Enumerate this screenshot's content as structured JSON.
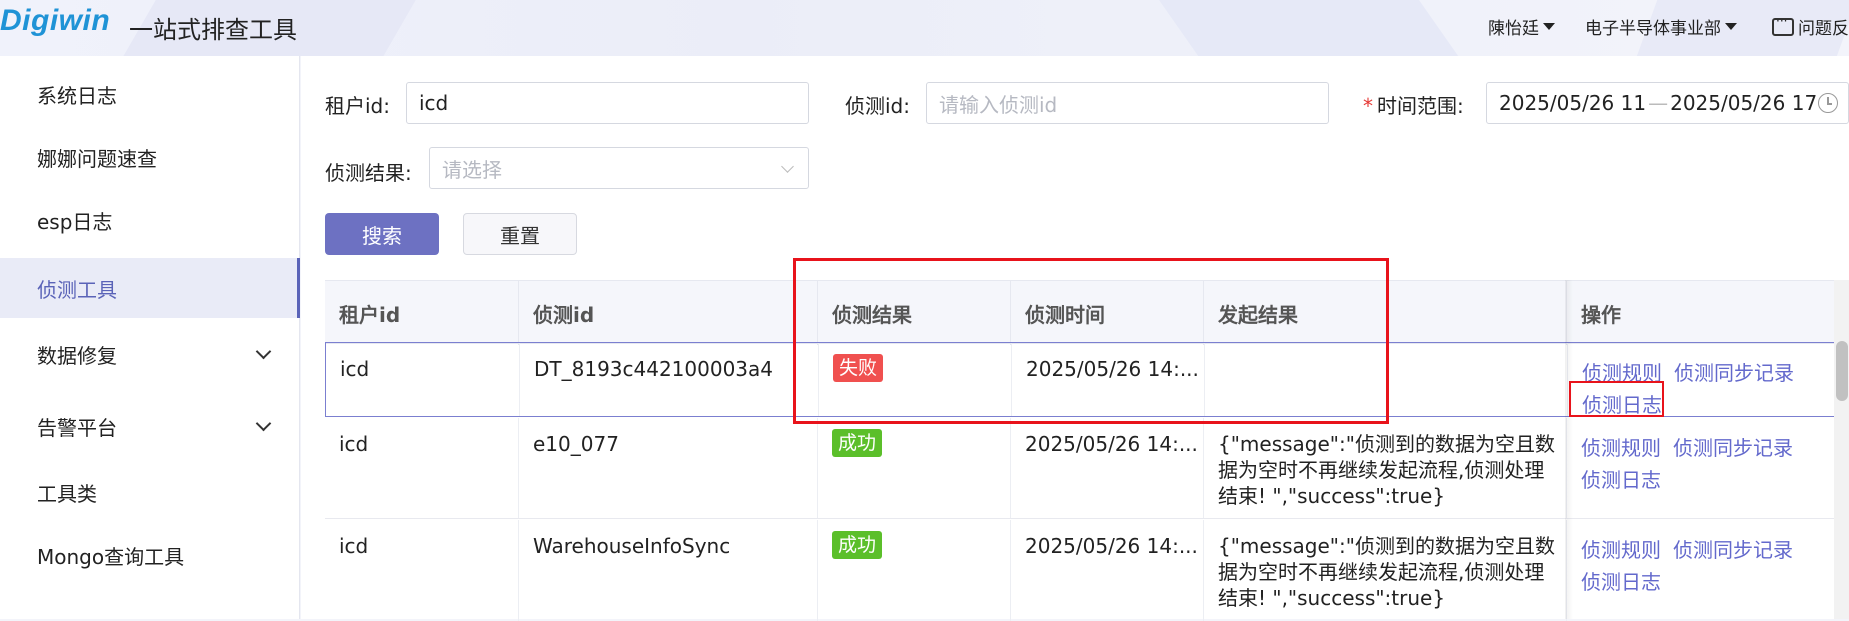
{
  "header": {
    "logo": "Digiwin",
    "title": "一站式排查工具",
    "user": "陳怡廷",
    "department": "电子半导体事业部",
    "feedback": "问题反"
  },
  "sidebar": {
    "items": [
      {
        "label": "系统日志"
      },
      {
        "label": "娜娜问题速查"
      },
      {
        "label": "esp日志"
      },
      {
        "label": "侦测工具",
        "active": true
      },
      {
        "label": "数据修复",
        "expandable": true
      },
      {
        "label": "告警平台",
        "expandable": true
      },
      {
        "label": "工具类"
      },
      {
        "label": "Mongo查询工具"
      }
    ]
  },
  "filters": {
    "tenant_label": "租户id:",
    "tenant_value": "icd",
    "detect_id_label": "侦测id:",
    "detect_id_placeholder": "请输入侦测id",
    "time_label": "时间范围:",
    "time_required": "*",
    "time_start": "2025/05/26 11",
    "time_sep": "—",
    "time_end": "2025/05/26 17",
    "result_label": "侦测结果:",
    "result_placeholder": "请选择",
    "search_btn": "搜索",
    "reset_btn": "重置"
  },
  "table": {
    "columns": [
      "租户id",
      "侦测id",
      "侦测结果",
      "侦测时间",
      "发起结果",
      "操作"
    ],
    "rows": [
      {
        "tenant": "icd",
        "detect_id": "DT_8193c442100003a4",
        "result": "失败",
        "result_type": "fail",
        "time": "2025/05/26 14:...",
        "initiate": "",
        "ops": [
          "侦测规则",
          "侦测同步记录",
          "侦测日志"
        ]
      },
      {
        "tenant": "icd",
        "detect_id": "e10_077",
        "result": "成功",
        "result_type": "ok",
        "time": "2025/05/26 14:...",
        "initiate": "{\"message\":\"侦测到的数据为空且数据为空时不再继续发起流程,侦测处理结束! \",\"success\":true}",
        "ops": [
          "侦测规则",
          "侦测同步记录",
          "侦测日志"
        ]
      },
      {
        "tenant": "icd",
        "detect_id": "WarehouseInfoSync",
        "result": "成功",
        "result_type": "ok",
        "time": "2025/05/26 14:...",
        "initiate": "{\"message\":\"侦测到的数据为空且数据为空时不再继续发起流程,侦测处理结束! \",\"success\":true}",
        "ops": [
          "侦测规则",
          "侦测同步记录",
          "侦测日志"
        ]
      }
    ]
  },
  "colors": {
    "accent": "#6d71c2",
    "link": "#6369cc",
    "fail": "#f0504f",
    "success": "#5bbf2a",
    "highlight": "#e8131b"
  }
}
